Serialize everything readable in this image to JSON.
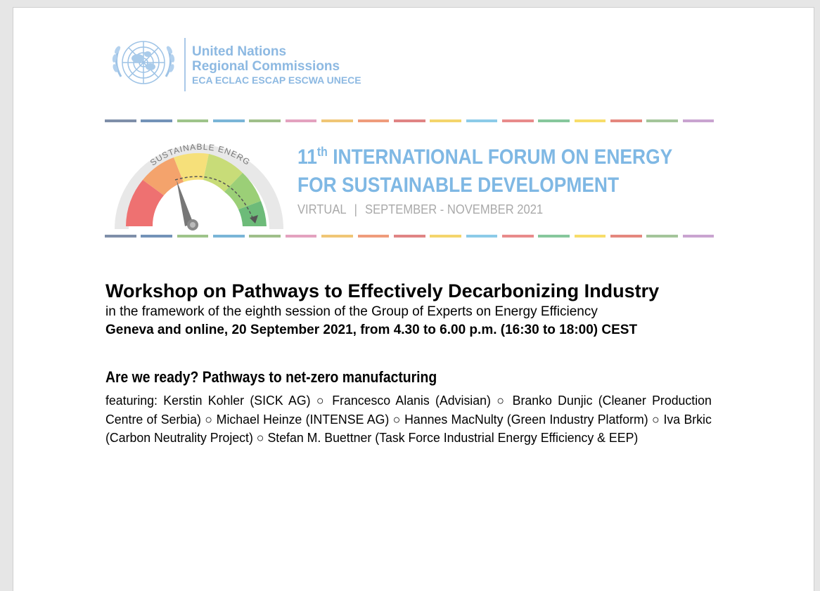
{
  "header": {
    "org_line1": "United Nations",
    "org_line2": "Regional Commissions",
    "org_line3": "ECA ECLAC ESCAP ESCWA UNECE"
  },
  "banner": {
    "gauge_label": "SUSTAINABLE ENERGY",
    "title_number": "11",
    "title_ordinal": "th",
    "title_line1_rest": " INTERNATIONAL FORUM ON ENERGY",
    "title_line2": "FOR SUSTAINABLE DEVELOPMENT",
    "format": "VIRTUAL",
    "separator": "|",
    "dates": "SEPTEMBER - NOVEMBER 2021",
    "stripe_colors": [
      "#7f8fa9",
      "#7393b8",
      "#9ec48a",
      "#7ab5d7",
      "#9fbf8a",
      "#e3a2bf",
      "#f0c676",
      "#ef9c7c",
      "#e08484",
      "#f4d56c",
      "#8ccbe8",
      "#e88b8b",
      "#86c79c",
      "#f7dd6a",
      "#e4877e",
      "#a4c59a",
      "#c9a4d0"
    ]
  },
  "workshop": {
    "title": "Workshop on Pathways to Effectively Decarbonizing Industry",
    "framework": "in the framework of the eighth session of the Group of Experts on Energy Efficiency",
    "datetime": "Geneva and online, 20 September 2021, from 4.30 to 6.00 p.m. (16:30 to 18:00) CEST"
  },
  "session": {
    "title": "Are we ready? Pathways to net-zero manufacturing",
    "featuring": "featuring: Kerstin Kohler (SICK AG) ○ Francesco Alanis (Advisian) ○ Branko Dunjic (Cleaner Production Centre of Serbia) ○ Michael Heinze (INTENSE AG) ○ Hannes MacNulty (Green Industry Platform) ○ Iva Brkic (Carbon Neutrality Project) ○ Stefan M. Buettner (Task Force Industrial Energy Efficiency & EEP)"
  },
  "colors": {
    "un_blue": "#8db9e2",
    "forum_blue": "#7fb8e4",
    "gray_text": "#a9a9a9"
  }
}
